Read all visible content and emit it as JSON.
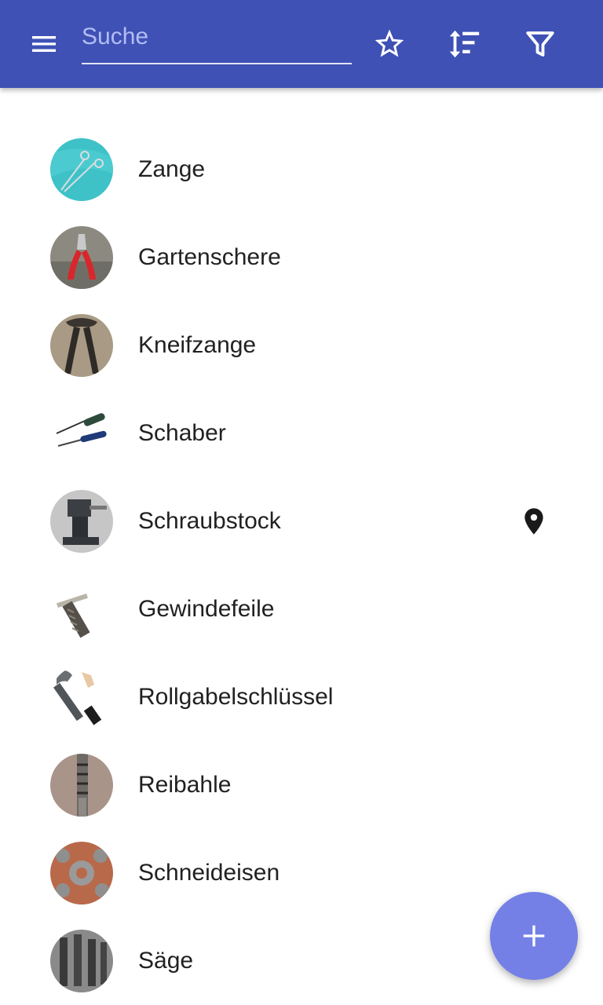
{
  "appbar": {
    "search_placeholder": "Suche",
    "search_value": "",
    "color": "#3f51b5",
    "icons": [
      "menu-icon",
      "star-icon",
      "sort-icon",
      "filter-icon"
    ]
  },
  "items": [
    {
      "label": "Zange",
      "image": "pliers-thumbnail"
    },
    {
      "label": "Gartenschere",
      "image": "pruning-shears-thumbnail"
    },
    {
      "label": "Kneifzange",
      "image": "pincers-thumbnail"
    },
    {
      "label": "Schaber",
      "image": "scraper-thumbnail"
    },
    {
      "label": "Schraubstock",
      "image": "vise-thumbnail",
      "location_icon": "location-pin-icon"
    },
    {
      "label": "Gewindefeile",
      "image": "thread-file-thumbnail"
    },
    {
      "label": "Rollgabelschlüssel",
      "image": "adjustable-wrench-thumbnail"
    },
    {
      "label": "Reibahle",
      "image": "reamer-thumbnail"
    },
    {
      "label": "Schneideisen",
      "image": "threading-die-thumbnail"
    },
    {
      "label": "Säge",
      "image": "saw-thumbnail"
    }
  ],
  "fab": {
    "icon": "plus-icon",
    "color": "#7480e6"
  }
}
